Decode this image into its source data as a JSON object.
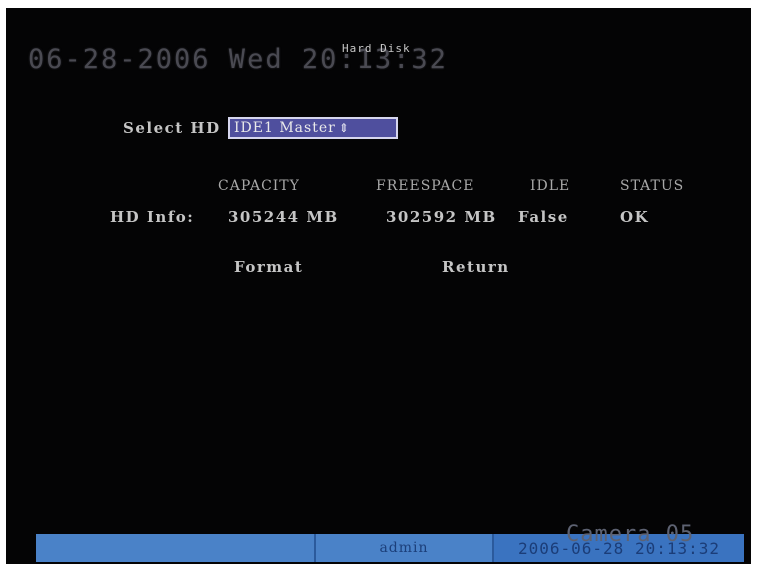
{
  "osd": {
    "datetime": "06-28-2006 Wed 20:13:32",
    "menu_title": "Hard Disk"
  },
  "select": {
    "label": "Select HD",
    "value": "IDE1 Master",
    "arrow_icon": "up-down-arrow-icon"
  },
  "table": {
    "headers": [
      "CAPACITY",
      "FREESPACE",
      "IDLE",
      "STATUS"
    ],
    "row_label": "HD Info:",
    "row": [
      "305244 MB",
      "302592 MB",
      "False",
      "OK"
    ]
  },
  "buttons": {
    "format": "Format",
    "return": "Return"
  },
  "camera_label": "Camera 05",
  "status_bar": {
    "left": "",
    "user": "admin",
    "datetime": "2006-06-28 20:13:32"
  },
  "colors": {
    "background": "#040405",
    "select_bg": "#4f4f9e",
    "status_bar": "#4a82c8"
  }
}
